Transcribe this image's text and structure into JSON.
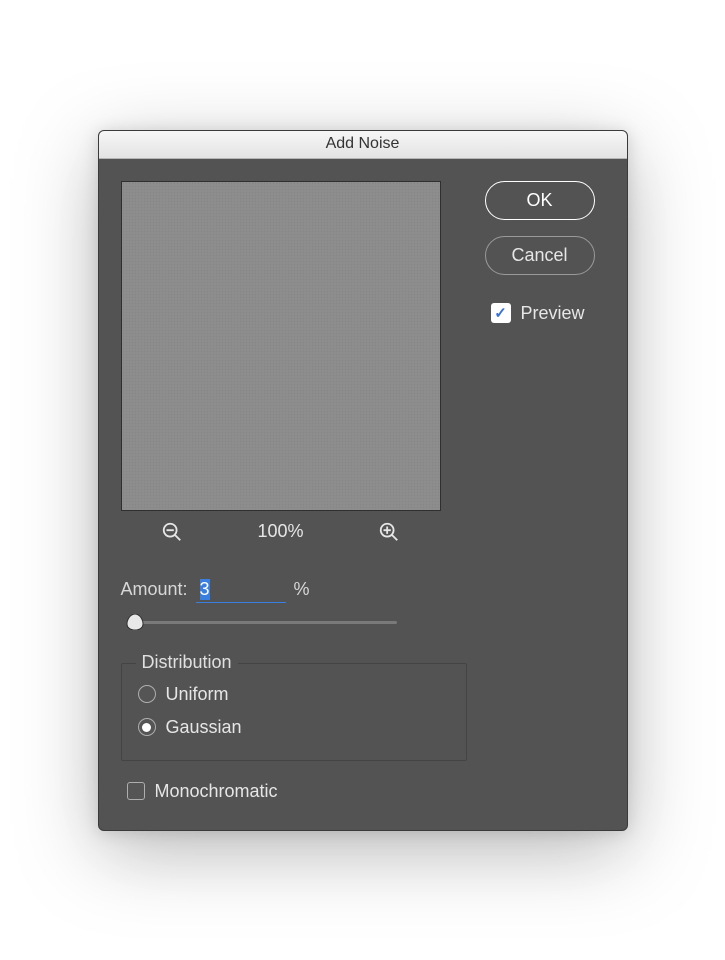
{
  "title": "Add Noise",
  "buttons": {
    "ok": "OK",
    "cancel": "Cancel"
  },
  "preview_label": "Preview",
  "preview_checked": true,
  "zoom": {
    "level": "100%"
  },
  "amount": {
    "label": "Amount:",
    "value": "3",
    "unit": "%",
    "slider_position_pct": 3
  },
  "distribution": {
    "legend": "Distribution",
    "options": [
      {
        "label": "Uniform",
        "selected": false
      },
      {
        "label": "Gaussian",
        "selected": true
      }
    ]
  },
  "monochromatic": {
    "label": "Monochromatic",
    "checked": false
  }
}
